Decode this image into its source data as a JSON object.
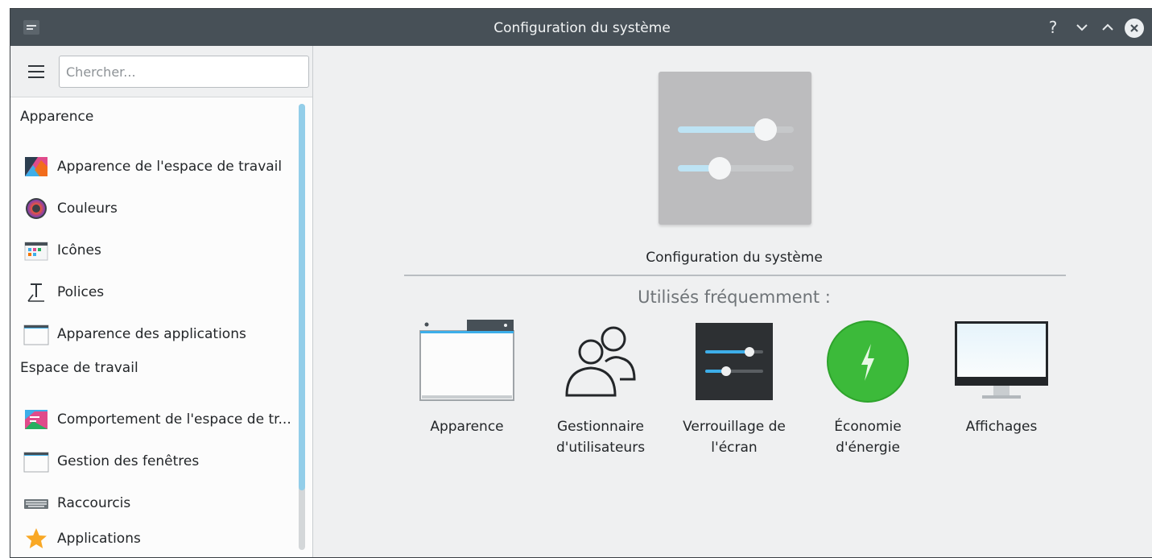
{
  "window": {
    "title": "Configuration du système",
    "controls": {
      "help": "?",
      "minimize": "⌄",
      "maximize": "⌃",
      "close": "✕"
    }
  },
  "sidebar": {
    "search_placeholder": "Chercher...",
    "sections": [
      {
        "title": "Apparence",
        "items": [
          {
            "label": "Apparence de l'espace de travail",
            "icon": "workspace-theme-icon"
          },
          {
            "label": "Couleurs",
            "icon": "colors-icon"
          },
          {
            "label": "Icônes",
            "icon": "icons-icon"
          },
          {
            "label": "Polices",
            "icon": "fonts-icon"
          },
          {
            "label": "Apparence des applications",
            "icon": "application-style-icon"
          }
        ]
      },
      {
        "title": "Espace de travail",
        "items": [
          {
            "label": "Comportement de l'espace de tr...",
            "icon": "workspace-behavior-icon"
          },
          {
            "label": "Gestion des fenêtres",
            "icon": "window-management-icon"
          },
          {
            "label": "Raccourcis",
            "icon": "keyboard-icon"
          },
          {
            "label": "Applications",
            "icon": "star-icon"
          }
        ]
      }
    ]
  },
  "main": {
    "hero_caption": "Configuration du système",
    "frequent_title": "Utilisés fréquemment :",
    "frequent_items": [
      {
        "label": "Apparence",
        "icon": "appearance-window-icon"
      },
      {
        "label": "Gestionnaire\nd'utilisateurs",
        "icon": "users-icon"
      },
      {
        "label": "Verrouillage de\nl'écran",
        "icon": "screen-lock-sliders-icon"
      },
      {
        "label": "Économie\nd'énergie",
        "icon": "power-lightning-icon"
      },
      {
        "label": "Affichages",
        "icon": "display-monitor-icon"
      }
    ]
  },
  "colors": {
    "titlebar": "#475057",
    "accent": "#93cee9",
    "power_green": "#3cba3a"
  }
}
